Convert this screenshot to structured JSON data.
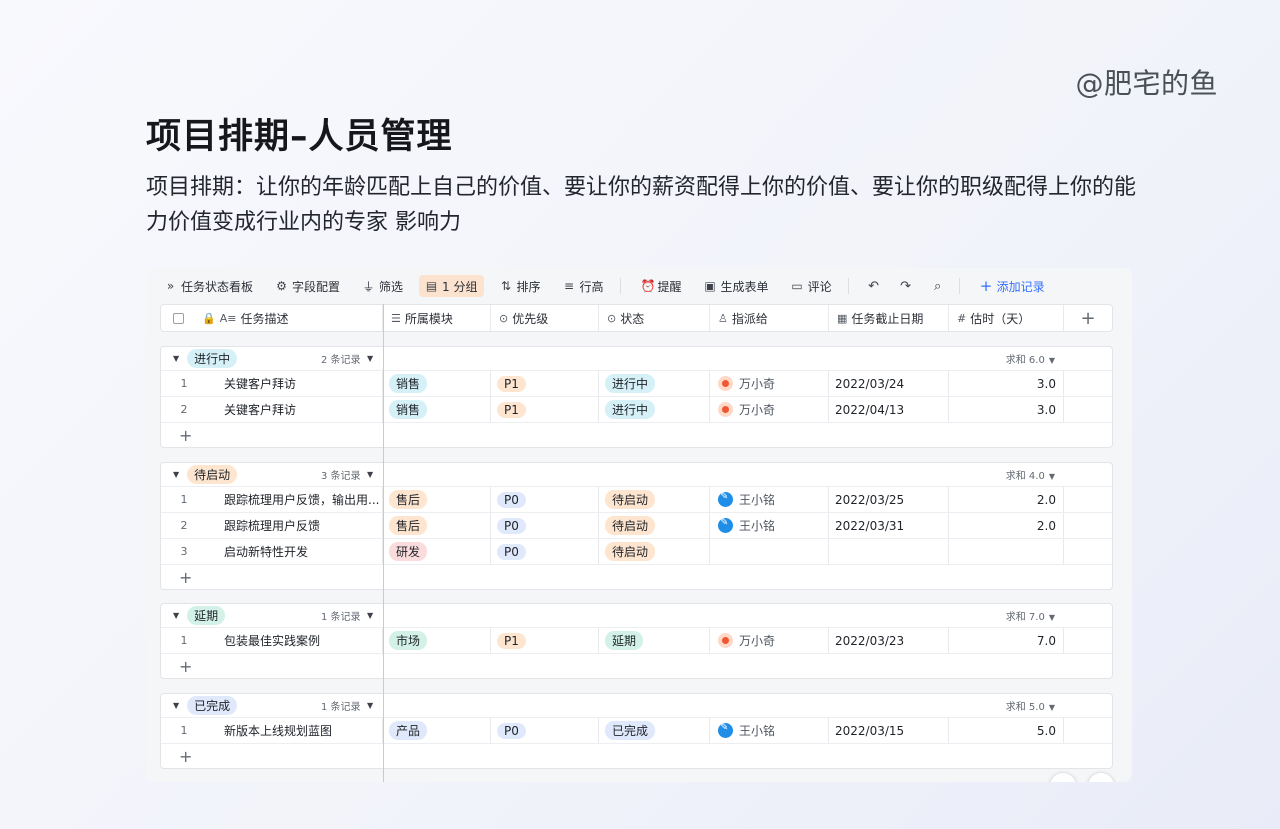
{
  "watermark": "@肥宅的鱼",
  "title": "项目排期–人员管理",
  "description": "项目排期：让你的年龄匹配上自己的价值、要让你的薪资配得上你的价值、要让你的职级配得上你的能力价值变成行业内的专家 影响力",
  "toolbar": {
    "view": "任务状态看板",
    "field_config": "字段配置",
    "filter": "筛选",
    "group": "1 分组",
    "sort": "排序",
    "row_height": "行高",
    "remind": "提醒",
    "form": "生成表单",
    "comment": "评论",
    "add_record": "添加记录"
  },
  "columns": {
    "desc": "任务描述",
    "module": "所属模块",
    "priority": "优先级",
    "status": "状态",
    "assignee": "指派给",
    "due": "任务截止日期",
    "estimate": "估时（天）",
    "add": "+"
  },
  "groups": [
    {
      "name": "进行中",
      "color": "#d5f1f7",
      "count": "2 条记录",
      "sum": "求和 6.0",
      "rows": [
        {
          "idx": "1",
          "desc": "关键客户拜访",
          "module": "销售",
          "module_color": "#d5f1f7",
          "priority": "P1",
          "priority_color": "#fde5cf",
          "status": "进行中",
          "status_color": "#d5f1f7",
          "assignee": "万小奇",
          "avatar": "orange",
          "due": "2022/03/24",
          "estimate": "3.0"
        },
        {
          "idx": "2",
          "desc": "关键客户拜访",
          "module": "销售",
          "module_color": "#d5f1f7",
          "priority": "P1",
          "priority_color": "#fde5cf",
          "status": "进行中",
          "status_color": "#d5f1f7",
          "assignee": "万小奇",
          "avatar": "orange",
          "due": "2022/04/13",
          "estimate": "3.0"
        }
      ]
    },
    {
      "name": "待启动",
      "color": "#fde5cf",
      "count": "3 条记录",
      "sum": "求和 4.0",
      "rows": [
        {
          "idx": "1",
          "desc": "跟踪梳理用户反馈，输出用...",
          "module": "售后",
          "module_color": "#fde5cf",
          "priority": "P0",
          "priority_color": "#dfe9fb",
          "status": "待启动",
          "status_color": "#fde5cf",
          "assignee": "王小铭",
          "avatar": "blue",
          "due": "2022/03/25",
          "estimate": "2.0"
        },
        {
          "idx": "2",
          "desc": "跟踪梳理用户反馈",
          "module": "售后",
          "module_color": "#fde5cf",
          "priority": "P0",
          "priority_color": "#dfe9fb",
          "status": "待启动",
          "status_color": "#fde5cf",
          "assignee": "王小铭",
          "avatar": "blue",
          "due": "2022/03/31",
          "estimate": "2.0"
        },
        {
          "idx": "3",
          "desc": "启动新特性开发",
          "module": "研发",
          "module_color": "#fbdcdc",
          "priority": "P0",
          "priority_color": "#dfe9fb",
          "status": "待启动",
          "status_color": "#fde5cf",
          "assignee": "",
          "avatar": "",
          "due": "",
          "estimate": ""
        }
      ]
    },
    {
      "name": "延期",
      "color": "#d3f1e6",
      "count": "1 条记录",
      "sum": "求和 7.0",
      "rows": [
        {
          "idx": "1",
          "desc": "包装最佳实践案例",
          "module": "市场",
          "module_color": "#d3f1e6",
          "priority": "P1",
          "priority_color": "#fde5cf",
          "status": "延期",
          "status_color": "#d3f1e6",
          "assignee": "万小奇",
          "avatar": "orange",
          "due": "2022/03/23",
          "estimate": "7.0"
        }
      ]
    },
    {
      "name": "已完成",
      "color": "#dfe9fb",
      "count": "1 条记录",
      "sum": "求和 5.0",
      "rows": [
        {
          "idx": "1",
          "desc": "新版本上线规划蓝图",
          "module": "产品",
          "module_color": "#dfe9fb",
          "priority": "P0",
          "priority_color": "#dfe9fb",
          "status": "已完成",
          "status_color": "#dfe9fb",
          "assignee": "王小铭",
          "avatar": "blue",
          "due": "2022/03/15",
          "estimate": "5.0"
        }
      ]
    }
  ]
}
